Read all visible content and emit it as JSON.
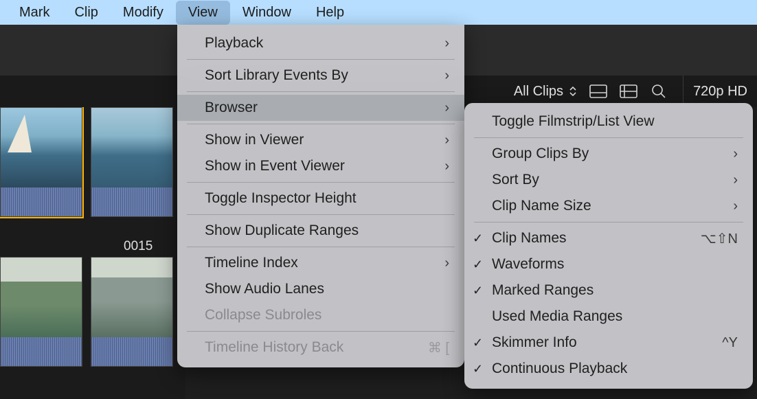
{
  "menubar": {
    "items": [
      "Mark",
      "Clip",
      "Modify",
      "View",
      "Window",
      "Help"
    ],
    "active_index": 3
  },
  "toolbar": {
    "all_clips_label": "All Clips",
    "quality_label": "720p HD"
  },
  "clips": {
    "label_0015": "0015"
  },
  "view_menu": {
    "playback": "Playback",
    "sort_library": "Sort Library Events By",
    "browser": "Browser",
    "show_viewer": "Show in Viewer",
    "show_event_viewer": "Show in Event Viewer",
    "toggle_inspector": "Toggle Inspector Height",
    "show_dup": "Show Duplicate Ranges",
    "timeline_index": "Timeline Index",
    "show_audio_lanes": "Show Audio Lanes",
    "collapse_subroles": "Collapse Subroles",
    "timeline_history_back": "Timeline History Back",
    "shortcut_history_back": "⌘ ["
  },
  "browser_submenu": {
    "toggle_filmstrip": "Toggle Filmstrip/List View",
    "group_clips": "Group Clips By",
    "sort_by": "Sort By",
    "clip_name_size": "Clip Name Size",
    "clip_names": "Clip Names",
    "clip_names_shortcut": "⌥⇧N",
    "waveforms": "Waveforms",
    "marked_ranges": "Marked Ranges",
    "used_media": "Used Media Ranges",
    "skimmer": "Skimmer Info",
    "skimmer_shortcut": "^Y",
    "continuous": "Continuous Playback"
  }
}
